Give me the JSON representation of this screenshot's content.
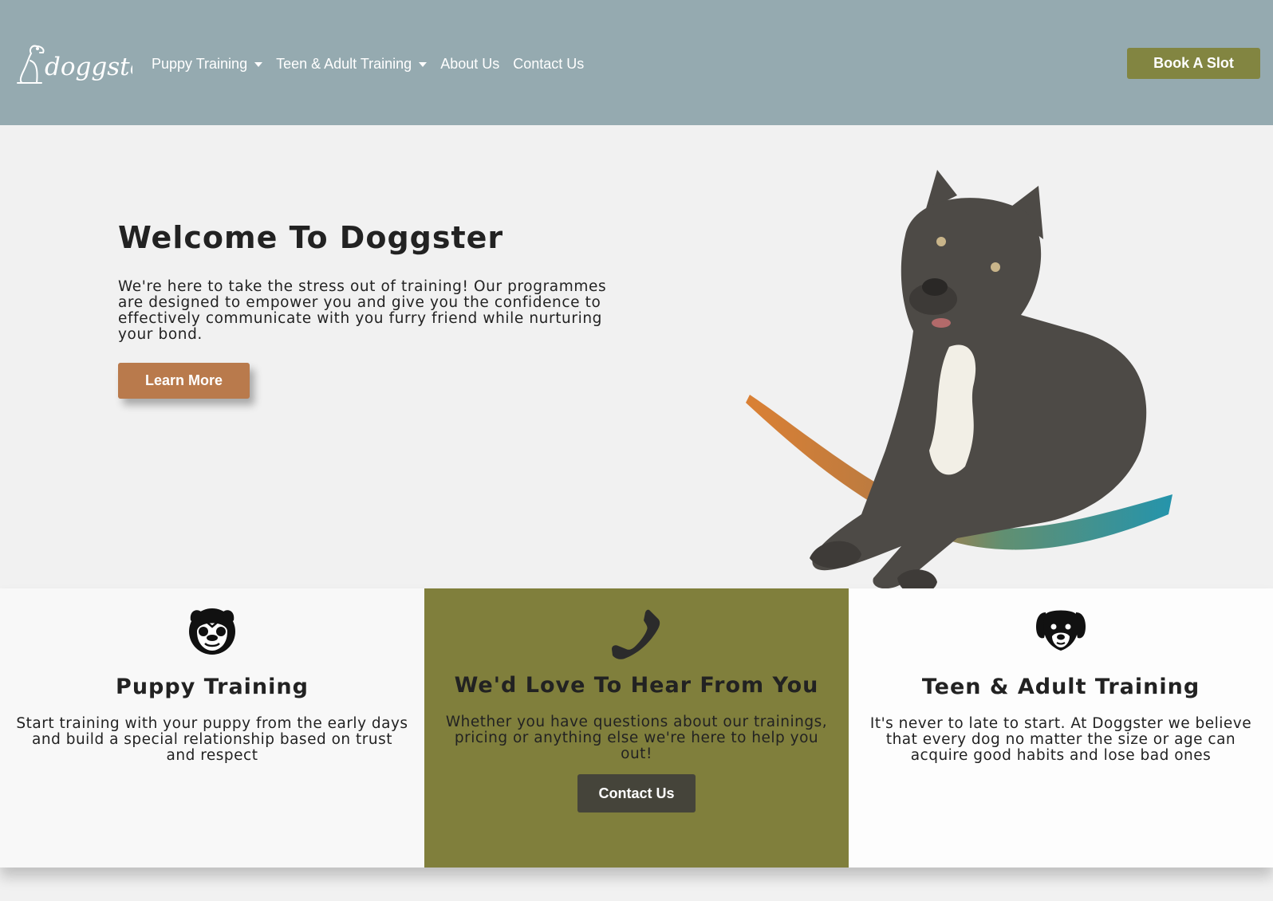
{
  "brand": {
    "logo_text": "doggster"
  },
  "nav": {
    "items": [
      {
        "label": "Puppy Training",
        "dropdown": true
      },
      {
        "label": "Teen & Adult Training",
        "dropdown": true
      },
      {
        "label": "About Us",
        "dropdown": false
      },
      {
        "label": "Contact Us",
        "dropdown": false
      }
    ],
    "cta_label": "Book A Slot"
  },
  "hero": {
    "title": "Welcome To Doggster",
    "text": "We're here to take the stress out of training! Our programmes are designed to empower you and give you the confidence to effectively communicate with you furry friend while nurturing your bond.",
    "button_label": "Learn More"
  },
  "cards": {
    "puppy": {
      "icon": "pug-face-icon",
      "title": "Puppy Training",
      "text": "Start training with your puppy from the early days and build a special relationship based on trust and respect"
    },
    "contact": {
      "icon": "phone-icon",
      "title": "We'd Love To Hear From You",
      "text": "Whether you have questions about our trainings, pricing or anything else we're here to help you out!",
      "button_label": "Contact Us"
    },
    "adult": {
      "icon": "dog-face-icon",
      "title": "Teen & Adult Training",
      "text": "It's never to late to start. At Doggster we believe that every dog no matter the size or age can acquire good habits and lose bad ones"
    }
  },
  "colors": {
    "navbar": "#95aab0",
    "olive": "#828541",
    "copper": "#b97a4c",
    "dark_button": "#45443a",
    "teal_brush": "#1a8fa8",
    "orange_brush": "#d97a2a"
  }
}
